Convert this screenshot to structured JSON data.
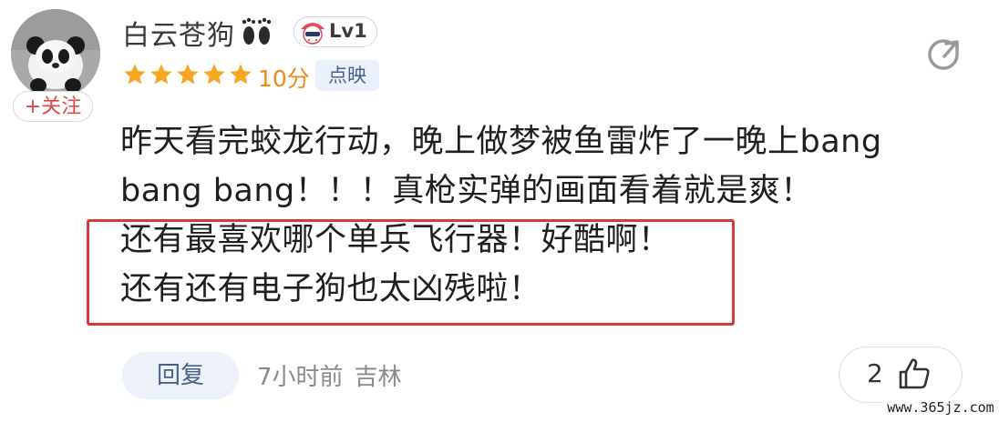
{
  "user": {
    "name": "白云苍狗",
    "level": "Lv1",
    "follow_label": "+关注"
  },
  "rating": {
    "stars": 5,
    "max_stars": 5,
    "score": "10分",
    "source_tag": "点映",
    "star_color": "#f6a623"
  },
  "comment": {
    "lines": [
      "昨天看完蛟龙行动，晚上做梦被鱼雷炸了一晚上bang",
      "bang bang！！！真枪实弹的画面看着就是爽！",
      "还有最喜欢哪个单兵飞行器！好酷啊！",
      "还有还有电子狗也太凶残啦！"
    ],
    "highlight_color": "#d9383d"
  },
  "footer": {
    "reply_label": "回复",
    "time": "7小时前",
    "location": "吉林",
    "like_count": "2"
  },
  "watermark": "www.365jz.com",
  "icons": {
    "feet": "footprints-icon",
    "level_avatar": "mascot-icon",
    "share": "share-icon",
    "thumb": "thumbs-up-icon"
  }
}
